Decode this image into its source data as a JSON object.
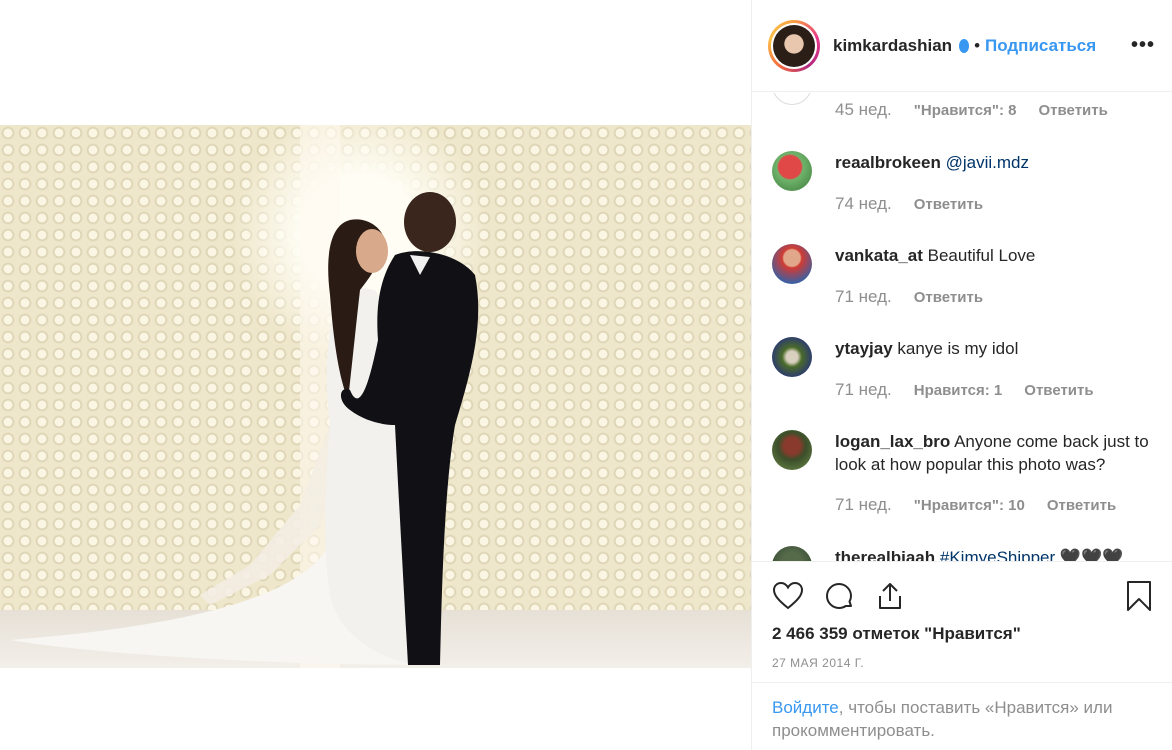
{
  "post": {
    "username": "kimkardashian",
    "dot": "•",
    "follow_label": "Подписаться",
    "more_label": "•••",
    "photo_description_icon": "wedding-photo"
  },
  "comments": [
    {
      "user": "",
      "text": "",
      "time": "45 нед.",
      "likes": "\"Нравится\": 8",
      "reply": "Ответить",
      "avatar_color": "#d9d9d9"
    },
    {
      "user": "reaalbrokeen",
      "text": "@javii.mdz",
      "time": "74 нед.",
      "likes": "",
      "reply": "Ответить",
      "avatar_color": "#c23a3a"
    },
    {
      "user": "vankata_at",
      "text": "Beautiful Love",
      "time": "71 нед.",
      "likes": "",
      "reply": "Ответить",
      "avatar_color": "#d64a3c"
    },
    {
      "user": "ytayjay",
      "text": "kanye is my idol",
      "time": "71 нед.",
      "likes": "Нравится: 1",
      "reply": "Ответить",
      "avatar_color": "#4f6a2f"
    },
    {
      "user": "logan_lax_bro",
      "text": "Anyone come back just to look at how popular this photo was?",
      "time": "71 нед.",
      "likes": "\"Нравится\": 10",
      "reply": "Ответить",
      "avatar_color": "#5a3a2c"
    },
    {
      "user": "therealbiaah",
      "text": "#KimyeShipper 🖤🖤🖤",
      "time": "",
      "likes": "",
      "reply": "",
      "avatar_color": "#3a4a3a"
    }
  ],
  "actions": {
    "like_icon": "heart-icon",
    "comment_icon": "comment-icon",
    "share_icon": "share-icon",
    "save_icon": "bookmark-icon",
    "likes_text": "2 466 359 отметок \"Нравится\"",
    "date": "27 МАЯ 2014 Г."
  },
  "login": {
    "link": "Войдите",
    "text": ", чтобы поставить «Нравится» или прокомментировать."
  }
}
